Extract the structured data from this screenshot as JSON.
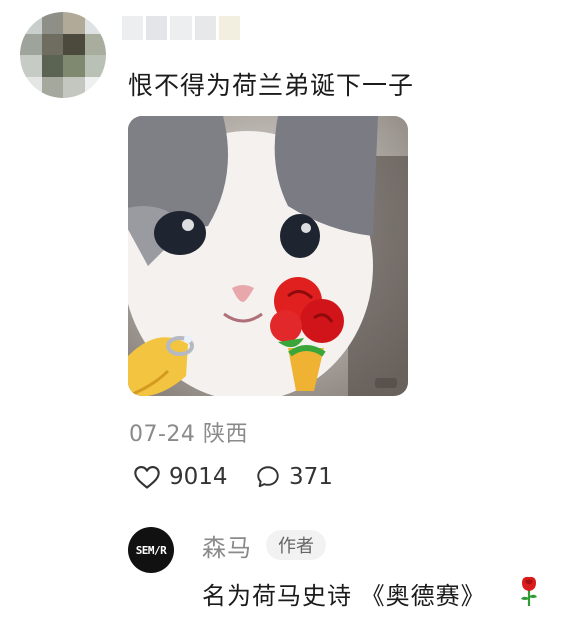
{
  "comment": {
    "text": "恨不得为荷兰弟诞下一子",
    "date": "07-24",
    "location": "陕西",
    "likes": "9014",
    "replies": "371"
  },
  "reply": {
    "avatar_text": "SEM/R",
    "author": "森马",
    "badge": "作者",
    "text": "名为荷马史诗 《奥德赛》"
  },
  "icons": {
    "like": "heart-outline-icon",
    "reply": "speech-bubble-icon",
    "emoji": "rose-icon"
  },
  "colors": {
    "text": "#1b1b1b",
    "meta": "#8a8a8a",
    "badge_bg": "#f2f2f2",
    "rose": "#d91c1c"
  }
}
